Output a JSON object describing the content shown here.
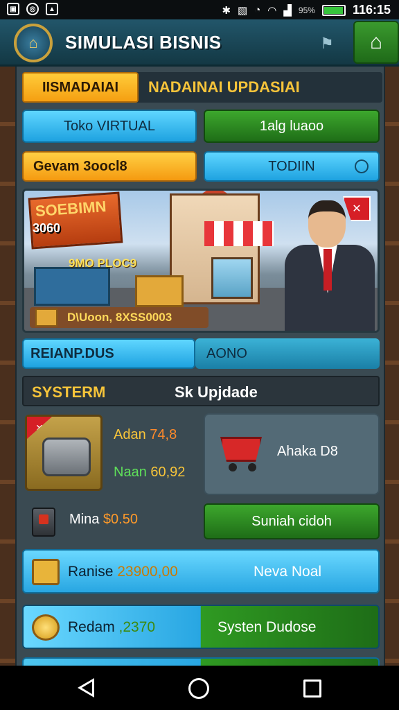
{
  "status_bar": {
    "battery_percent": "95%",
    "battery_level": 0.95,
    "time": "116:15"
  },
  "app": {
    "title": "SIMULASI BISNIS"
  },
  "tabs": {
    "active": "IISMADAIAI",
    "inactive": "NADAINAI UPDASIAI"
  },
  "buttons": {
    "toko": "Toko VIRTUAL",
    "lalu": "1alg luaoo",
    "gevam": "Gevam 3oocl8",
    "todin": "TODIIN"
  },
  "banner": {
    "sign": "SOEBIMN",
    "sign_number": "3060",
    "caption1": "9MO PLOC9",
    "caption2": "D\\Uoon, 8XSS0003"
  },
  "segments": {
    "left": "REIANP.DUS",
    "right": "AONO"
  },
  "system": {
    "left": "SYSTERM",
    "right_prefix": "Sk",
    "right": "Upjdade"
  },
  "upgrade": {
    "line1_label": "Adan",
    "line1_value": "74,8",
    "line2_label": "Naan",
    "line2_value": "60,92",
    "right_label": "Ahaka D8"
  },
  "mina": {
    "label": "Mina",
    "value": "$0.50",
    "button": "Suniah cidoh"
  },
  "rows": [
    {
      "label": "Ranise",
      "value": "23900,00",
      "right": "Neva Noal"
    },
    {
      "label": "Redam",
      "value": ",2370",
      "right": "Systen Dudose"
    }
  ]
}
